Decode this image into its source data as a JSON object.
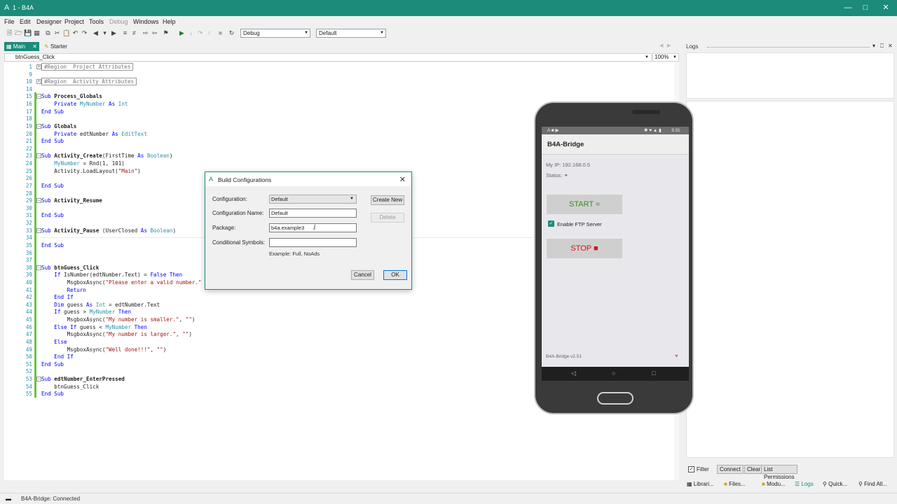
{
  "window": {
    "title": "1 - B4A"
  },
  "menu": [
    "File",
    "Edit",
    "Designer",
    "Project",
    "Tools",
    "Debug",
    "Windows",
    "Help"
  ],
  "toolbar": {
    "build_mode": "Debug",
    "build_config": "Default"
  },
  "tabs": {
    "main": "Main",
    "starter": "Starter"
  },
  "method_bar": {
    "current": "btnGuess_Click",
    "zoom": "100%"
  },
  "code_lines": [
    {
      "n": "1",
      "fold": "+",
      "region": "#Region  Project Attributes"
    },
    {
      "n": "9"
    },
    {
      "n": "10",
      "fold": "+",
      "region": "#Region  Activity Attributes"
    },
    {
      "n": "14"
    },
    {
      "n": "15",
      "fold": "-",
      "segs": [
        [
          "kw",
          "Sub "
        ],
        [
          "fn",
          "Process_Globals"
        ]
      ]
    },
    {
      "n": "16",
      "segs": [
        [
          "",
          "    "
        ],
        [
          "kw",
          "Private "
        ],
        [
          "ty",
          "MyNumber"
        ],
        [
          "kw",
          " As "
        ],
        [
          "ty",
          "Int"
        ]
      ]
    },
    {
      "n": "17",
      "segs": [
        [
          "kw",
          "End Sub"
        ]
      ]
    },
    {
      "n": "18"
    },
    {
      "n": "19",
      "fold": "-",
      "segs": [
        [
          "kw",
          "Sub "
        ],
        [
          "fn",
          "Globals"
        ]
      ]
    },
    {
      "n": "20",
      "segs": [
        [
          "",
          "    "
        ],
        [
          "kw",
          "Private "
        ],
        [
          "",
          "edtNumber"
        ],
        [
          "kw",
          " As "
        ],
        [
          "ty",
          "EditText"
        ]
      ]
    },
    {
      "n": "21",
      "segs": [
        [
          "kw",
          "End Sub"
        ]
      ]
    },
    {
      "n": "22"
    },
    {
      "n": "23",
      "fold": "-",
      "segs": [
        [
          "kw",
          "Sub "
        ],
        [
          "fn",
          "Activity_Create"
        ],
        [
          "",
          "(FirstTime "
        ],
        [
          "kw",
          "As "
        ],
        [
          "ty",
          "Boolean"
        ],
        [
          "",
          ")"
        ]
      ]
    },
    {
      "n": "24",
      "segs": [
        [
          "",
          "    "
        ],
        [
          "ty",
          "MyNumber"
        ],
        [
          "",
          " = Rnd(1, 101)"
        ]
      ]
    },
    {
      "n": "25",
      "segs": [
        [
          "",
          "    Activity.LoadLayout("
        ],
        [
          "str",
          "\"Main\""
        ],
        [
          "",
          ")"
        ]
      ]
    },
    {
      "n": "26"
    },
    {
      "n": "27",
      "segs": [
        [
          "kw",
          "End Sub"
        ]
      ]
    },
    {
      "n": "28"
    },
    {
      "n": "29",
      "fold": "-",
      "segs": [
        [
          "kw",
          "Sub "
        ],
        [
          "fn",
          "Activity_Resume"
        ]
      ]
    },
    {
      "n": "30"
    },
    {
      "n": "31",
      "segs": [
        [
          "kw",
          "End Sub"
        ]
      ]
    },
    {
      "n": "32"
    },
    {
      "n": "33",
      "fold": "-",
      "segs": [
        [
          "kw",
          "Sub "
        ],
        [
          "fn",
          "Activity_Pause"
        ],
        [
          "",
          " (UserClosed "
        ],
        [
          "kw",
          "As "
        ],
        [
          "ty",
          "Boolean"
        ],
        [
          "",
          ")"
        ]
      ]
    },
    {
      "n": "34"
    },
    {
      "n": "35",
      "segs": [
        [
          "kw",
          "End Sub"
        ]
      ]
    },
    {
      "n": "36"
    },
    {
      "n": "37"
    },
    {
      "n": "38",
      "fold": "-",
      "segs": [
        [
          "kw",
          "Sub "
        ],
        [
          "fn",
          "btnGuess_Click"
        ]
      ]
    },
    {
      "n": "39",
      "segs": [
        [
          "",
          "    "
        ],
        [
          "kw",
          "If "
        ],
        [
          "",
          "IsNumber(edtNumber.Text) = "
        ],
        [
          "kw",
          "False Then"
        ]
      ]
    },
    {
      "n": "40",
      "segs": [
        [
          "",
          "        MsgboxAsync("
        ],
        [
          "str",
          "\"Please enter a valid number.\""
        ]
      ]
    },
    {
      "n": "41",
      "segs": [
        [
          "",
          "        "
        ],
        [
          "kw",
          "Return"
        ]
      ]
    },
    {
      "n": "42",
      "segs": [
        [
          "",
          "    "
        ],
        [
          "kw",
          "End If"
        ]
      ]
    },
    {
      "n": "43",
      "segs": [
        [
          "",
          "    "
        ],
        [
          "kw",
          "Dim "
        ],
        [
          "",
          "guess "
        ],
        [
          "kw",
          "As "
        ],
        [
          "ty",
          "Int"
        ],
        [
          "",
          " = edtNumber.Text"
        ]
      ]
    },
    {
      "n": "44",
      "segs": [
        [
          "",
          "    "
        ],
        [
          "kw",
          "If "
        ],
        [
          "",
          "guess > "
        ],
        [
          "ty",
          "MyNumber"
        ],
        [
          "kw",
          " Then"
        ]
      ]
    },
    {
      "n": "45",
      "segs": [
        [
          "",
          "        MsgboxAsync("
        ],
        [
          "str",
          "\"My number is smaller.\""
        ],
        [
          "",
          ", "
        ],
        [
          "str",
          "\"\""
        ],
        [
          "",
          ")"
        ]
      ]
    },
    {
      "n": "46",
      "segs": [
        [
          "",
          "    "
        ],
        [
          "kw",
          "Else If "
        ],
        [
          "",
          "guess < "
        ],
        [
          "ty",
          "MyNumber"
        ],
        [
          "kw",
          " Then"
        ]
      ]
    },
    {
      "n": "47",
      "segs": [
        [
          "",
          "        MsgboxAsync("
        ],
        [
          "str",
          "\"My number is larger.\""
        ],
        [
          "",
          ", "
        ],
        [
          "str",
          "\"\""
        ],
        [
          "",
          ")"
        ]
      ]
    },
    {
      "n": "48",
      "segs": [
        [
          "",
          "    "
        ],
        [
          "kw",
          "Else"
        ]
      ]
    },
    {
      "n": "49",
      "segs": [
        [
          "",
          "        MsgboxAsync("
        ],
        [
          "str",
          "\"Well done!!!\""
        ],
        [
          "",
          ", "
        ],
        [
          "str",
          "\"\""
        ],
        [
          "",
          ")"
        ]
      ]
    },
    {
      "n": "50",
      "segs": [
        [
          "",
          "    "
        ],
        [
          "kw",
          "End If"
        ]
      ]
    },
    {
      "n": "51",
      "segs": [
        [
          "kw",
          "End Sub"
        ]
      ]
    },
    {
      "n": "52"
    },
    {
      "n": "53",
      "fold": "-",
      "segs": [
        [
          "kw",
          "Sub "
        ],
        [
          "fn",
          "edtNumber_EnterPressed"
        ]
      ]
    },
    {
      "n": "54",
      "segs": [
        [
          "",
          "    btnGuess_Click"
        ]
      ]
    },
    {
      "n": "55",
      "segs": [
        [
          "kw",
          "End Sub"
        ]
      ]
    }
  ],
  "dialog": {
    "title": "Build Configurations",
    "configuration_label": "Configuration:",
    "configuration_value": "Default",
    "config_name_label": "Configuration Name:",
    "config_name_value": "Default",
    "package_label": "Package:",
    "package_value": "b4a.example3",
    "symbols_label": "Conditional Symbols:",
    "symbols_value": "",
    "hint": "Example: Full, NoAds",
    "create_new": "Create New",
    "delete": "Delete",
    "cancel": "Cancel",
    "ok": "OK"
  },
  "logs": {
    "title": "Logs",
    "filter": "Filter",
    "connect": "Connect",
    "clear": "Clear",
    "list_permissions": "List Permissions"
  },
  "bottom_tabs": [
    "Librari...",
    "Files...",
    "Modu...",
    "Logs",
    "Quick...",
    "Find All..."
  ],
  "status": {
    "text": "B4A-Bridge: Connected"
  },
  "phone": {
    "time": "3:31",
    "app_title": "B4A-Bridge",
    "ip_text": "My IP: 192.168.0.5",
    "status_text": "Status:",
    "start_label": "START",
    "ftp_label": "Enable FTP Server",
    "stop_label": "STOP",
    "version": "B4A-Bridge v2.51"
  },
  "colors": {
    "accent": "#1c8b7a",
    "keyword": "#0000ff",
    "type": "#2b91af",
    "string": "#a31515"
  }
}
